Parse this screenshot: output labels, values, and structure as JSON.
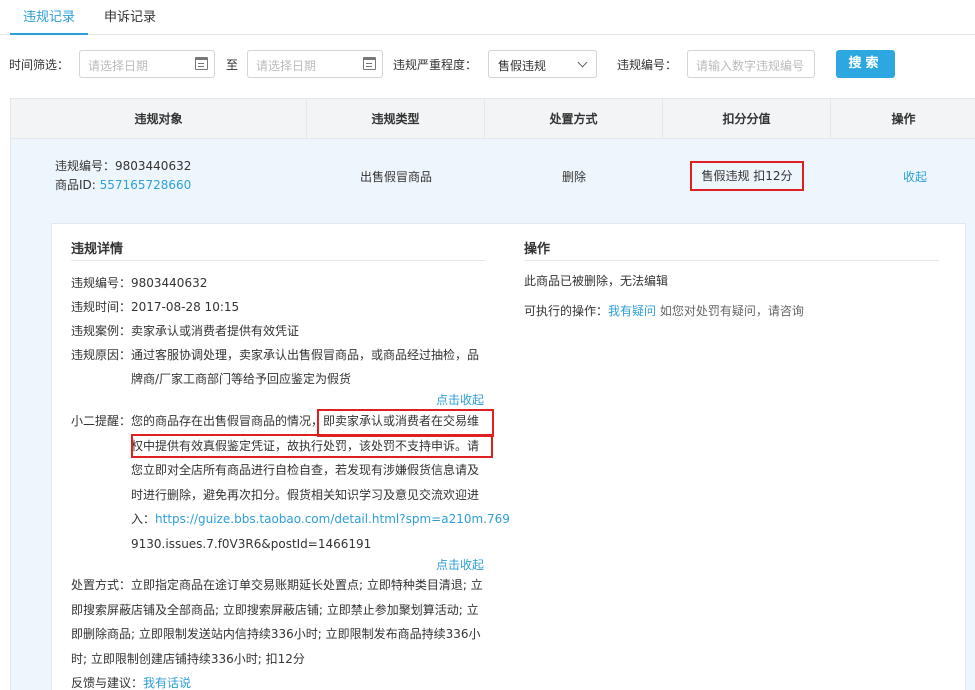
{
  "tabs": [
    {
      "label": "违规记录",
      "active": true
    },
    {
      "label": "申诉记录",
      "active": false
    }
  ],
  "filters": {
    "time_label": "时间筛选：",
    "start_placeholder": "请选择日期",
    "to_label": "至",
    "end_placeholder": "请选择日期",
    "severity_label": "违规严重程度：",
    "severity_value": "售假违规",
    "code_label": "违规编号：",
    "code_placeholder": "请输入数字违规编号",
    "search_label": "搜索"
  },
  "table": {
    "headers": [
      "违规对象",
      "违规类型",
      "处置方式",
      "扣分分值",
      "操作"
    ],
    "row": {
      "code_line": "违规编号：9803440632",
      "item_prefix": "商品ID:",
      "item_id": "557165728660",
      "type": "出售假冒商品",
      "disposition": "删除",
      "score": "售假违规 扣12分",
      "action": "收起"
    }
  },
  "detail": {
    "title": "违规详情",
    "code_label": "违规编号：",
    "code_value": "9803440632",
    "time_label": "违规时间：",
    "time_value": "2017-08-28 10:15",
    "case_label": "违规案例：",
    "case_value": "卖家承认或消费者提供有效凭证",
    "reason_label": "违规原因：",
    "reason_lines": [
      "通过客服协调处理，卖家承认出售假冒商品，或商品经过抽检，品",
      "牌商/厂家工商部门等给予回应鉴定为假货"
    ],
    "collapse_1": "点击收起",
    "tip_label": "小二提醒：",
    "tip_lines": [
      "您的商品存在出售假冒商品的情况，即卖家承认或消费者在交易维",
      "权中提供有效真假鉴定凭证，故执行处罚，该处罚不支持申诉。请",
      "您立即对全店所有商品进行自检自查，若发现有涉嫌假货信息请及",
      "时进行删除，避免再次扣分。假货相关知识学习及意见交流欢迎进"
    ],
    "tip_link_prefix": "入：",
    "tip_link_1": "https://guize.bbs.taobao.com/detail.html?spm=a210m.769",
    "tip_link_2": "9130.issues.7.f0V3R6&postId=1466191",
    "collapse_2": "点击收起",
    "disposition_lines": [
      "处置方式：立即指定商品在途订单交易账期延长处置点; 立即特种类目清退; 立",
      "即搜索屏蔽店铺及全部商品; 立即搜索屏蔽店铺; 立即禁止参加聚划算活动; 立",
      "即删除商品; 立即限制发送站内信持续336小时; 立即限制发布商品持续336小",
      "时; 立即限制创建店铺持续336小时; 扣12分"
    ],
    "feedback_label": "反馈与建议：",
    "feedback_link": "我有话说"
  },
  "operation": {
    "title": "操作",
    "status": "此商品已被删除，无法编辑",
    "exec_label": "可执行的操作：",
    "exec_link": "我有疑问",
    "exec_hint": "如您对处罚有疑问，请咨询"
  },
  "colors": {
    "accent": "#2d9fd8",
    "highlight_box": "#e02020",
    "row_bg": "#eef6fd"
  }
}
